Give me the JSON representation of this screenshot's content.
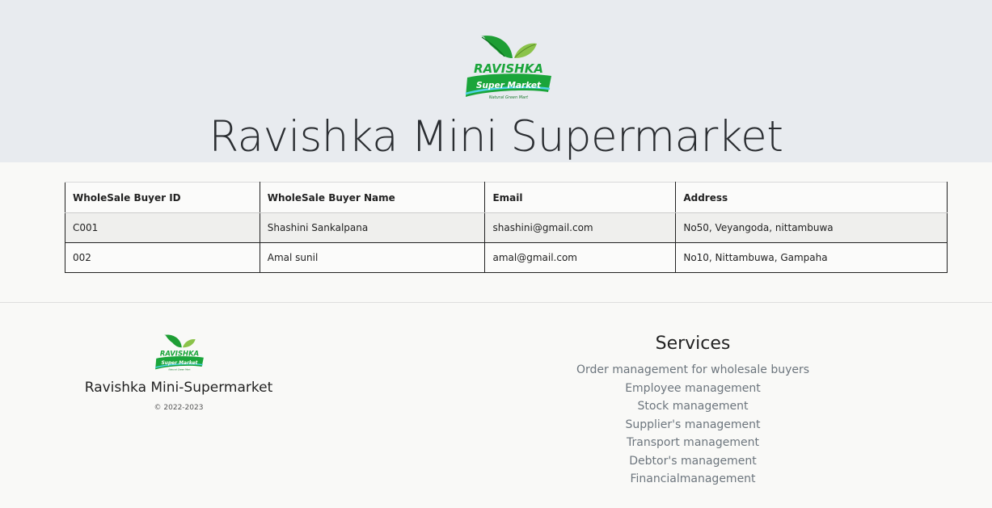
{
  "header": {
    "title": "Ravishka Mini Supermarket",
    "logo": {
      "brand": "RAVISHKA",
      "tagline": "Super Market",
      "subtag": "Natural Green Mart"
    }
  },
  "table": {
    "columns": [
      "WholeSale Buyer ID",
      "WholeSale Buyer Name",
      "Email",
      "Address"
    ],
    "rows": [
      [
        "C001",
        "Shashini Sankalpana",
        "shashini@gmail.com",
        "No50, Veyangoda, nittambuwa"
      ],
      [
        "002",
        "Amal sunil",
        "amal@gmail.com",
        "No10, Nittambuwa, Gampaha"
      ]
    ]
  },
  "footer": {
    "company_name": "Ravishka Mini-Supermarket",
    "copyright": "© 2022-2023",
    "services_title": "Services",
    "services": [
      "Order management for wholesale buyers",
      "Employee management",
      "Stock management",
      "Supplier's management",
      "Transport management",
      "Debtor's management",
      "Financialmanagement"
    ]
  },
  "colors": {
    "header_bg": "#e8ebef",
    "page_bg": "#f9f9f7",
    "logo_green": "#1aa53a",
    "logo_leaf_light": "#8bc34a",
    "service_text": "#6c757d"
  }
}
